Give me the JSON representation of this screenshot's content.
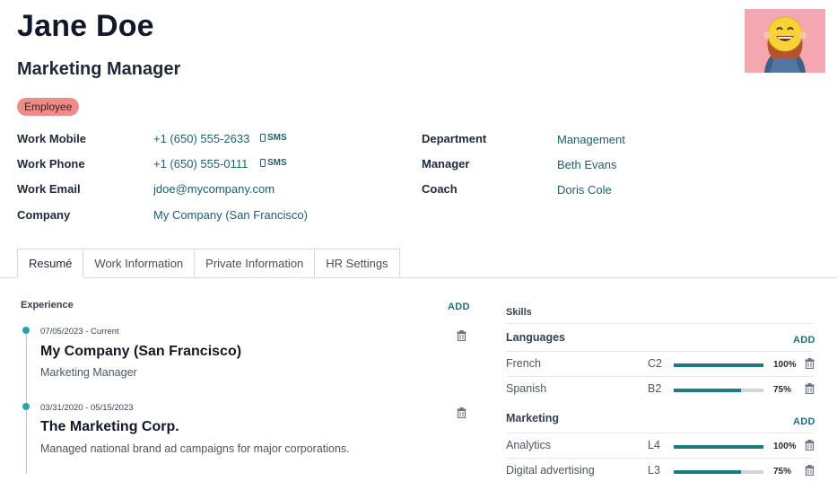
{
  "employee": {
    "name": "Jane Doe",
    "job_title": "Marketing Manager",
    "tag": "Employee"
  },
  "fields_left": [
    {
      "label": "Work Mobile",
      "value": "+1 (650) 555-2633",
      "sms": "SMS"
    },
    {
      "label": "Work Phone",
      "value": "+1 (650) 555-0111",
      "sms": "SMS"
    },
    {
      "label": "Work Email",
      "value": "jdoe@mycompany.com"
    },
    {
      "label": "Company",
      "value": "My Company (San Francisco)"
    }
  ],
  "fields_right": [
    {
      "label": "Department",
      "value": "Management"
    },
    {
      "label": "Manager",
      "value": "Beth Evans"
    },
    {
      "label": "Coach",
      "value": "Doris Cole"
    }
  ],
  "tabs": [
    {
      "label": "Resumé",
      "active": true
    },
    {
      "label": "Work Information",
      "active": false
    },
    {
      "label": "Private Information",
      "active": false
    },
    {
      "label": "HR Settings",
      "active": false
    }
  ],
  "experience": {
    "title": "Experience",
    "add_label": "ADD",
    "items": [
      {
        "date": "07/05/2023 - Current",
        "title": "My Company (San Francisco)",
        "description": "Marketing Manager"
      },
      {
        "date": "03/31/2020 - 05/15/2023",
        "title": "The Marketing Corp.",
        "description": "Managed national brand ad campaigns for major corporations."
      }
    ]
  },
  "skills": {
    "title": "Skills",
    "groups": [
      {
        "name": "Languages",
        "add_label": "ADD",
        "items": [
          {
            "name": "French",
            "level": "C2",
            "percent": 100,
            "percent_label": "100%"
          },
          {
            "name": "Spanish",
            "level": "B2",
            "percent": 75,
            "percent_label": "75%"
          }
        ]
      },
      {
        "name": "Marketing",
        "add_label": "ADD",
        "items": [
          {
            "name": "Analytics",
            "level": "L4",
            "percent": 100,
            "percent_label": "100%"
          },
          {
            "name": "Digital advertising",
            "level": "L3",
            "percent": 75,
            "percent_label": "75%"
          }
        ]
      }
    ]
  },
  "colors": {
    "accent": "#1d5f6b",
    "tag_bg": "#f08c88",
    "bar_fill": "#1a7d7d",
    "timeline_dot": "#2aa1b3"
  }
}
